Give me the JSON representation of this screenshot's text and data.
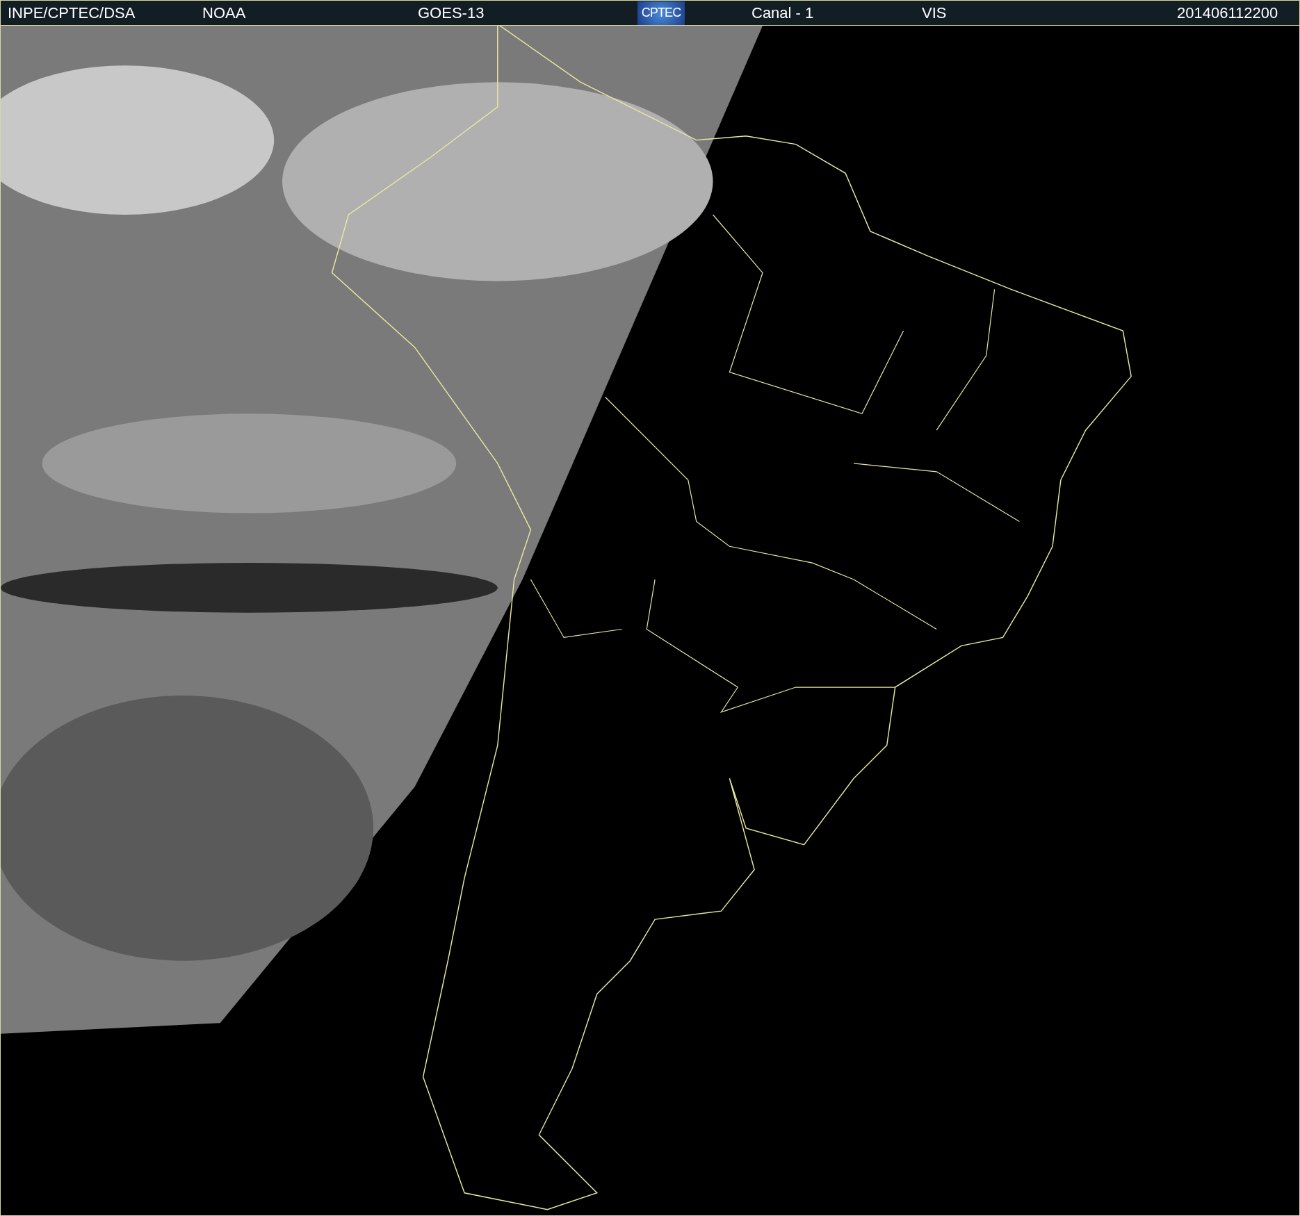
{
  "header": {
    "items": [
      {
        "kind": "text",
        "text": "INPE/CPTEC/DSA"
      },
      {
        "kind": "text",
        "text": "NOAA"
      },
      {
        "kind": "text",
        "text": "GOES-13"
      },
      {
        "kind": "logo",
        "text": "CPTEC"
      },
      {
        "kind": "text",
        "text": "Canal - 1"
      },
      {
        "kind": "text",
        "text": "VIS"
      },
      {
        "kind": "text",
        "text": "201406112200"
      }
    ]
  }
}
